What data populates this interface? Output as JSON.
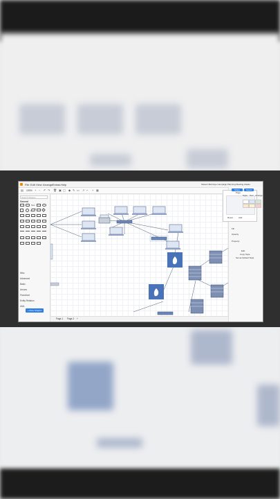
{
  "window": {
    "title": "Sistemi Berli Eye Campaign Planning Meeting.drawio"
  },
  "menu": [
    "File",
    "Edit",
    "View",
    "Arrange",
    "Extras",
    "Help"
  ],
  "toolbar": {
    "zoom": "100%"
  },
  "header_buttons": {
    "share": "Share",
    "save": "Saved"
  },
  "sidebar": {
    "search_placeholder": "Search Shapes",
    "general_label": "General",
    "sections": [
      "Misc",
      "Advanced",
      "Basic",
      "Arrows",
      "Flowchart",
      "Entity Relation",
      "UML"
    ],
    "more_shapes": "+ More Shapes"
  },
  "format_panel": {
    "tabs": [
      "Style",
      "Text",
      "Arrange"
    ],
    "items": [
      "Fill",
      "Opacity",
      "Property",
      "Edit",
      "Copy Style",
      "Set as Default Style"
    ]
  },
  "outline_panel": {
    "title": "Page",
    "buttons": [
      "Reset",
      "Add"
    ]
  },
  "pages": [
    "Page-1",
    "Page-2"
  ],
  "colors": {
    "accent": "#2f7ee6",
    "node": "#6c86b8",
    "firewall": "#4a72b8"
  }
}
